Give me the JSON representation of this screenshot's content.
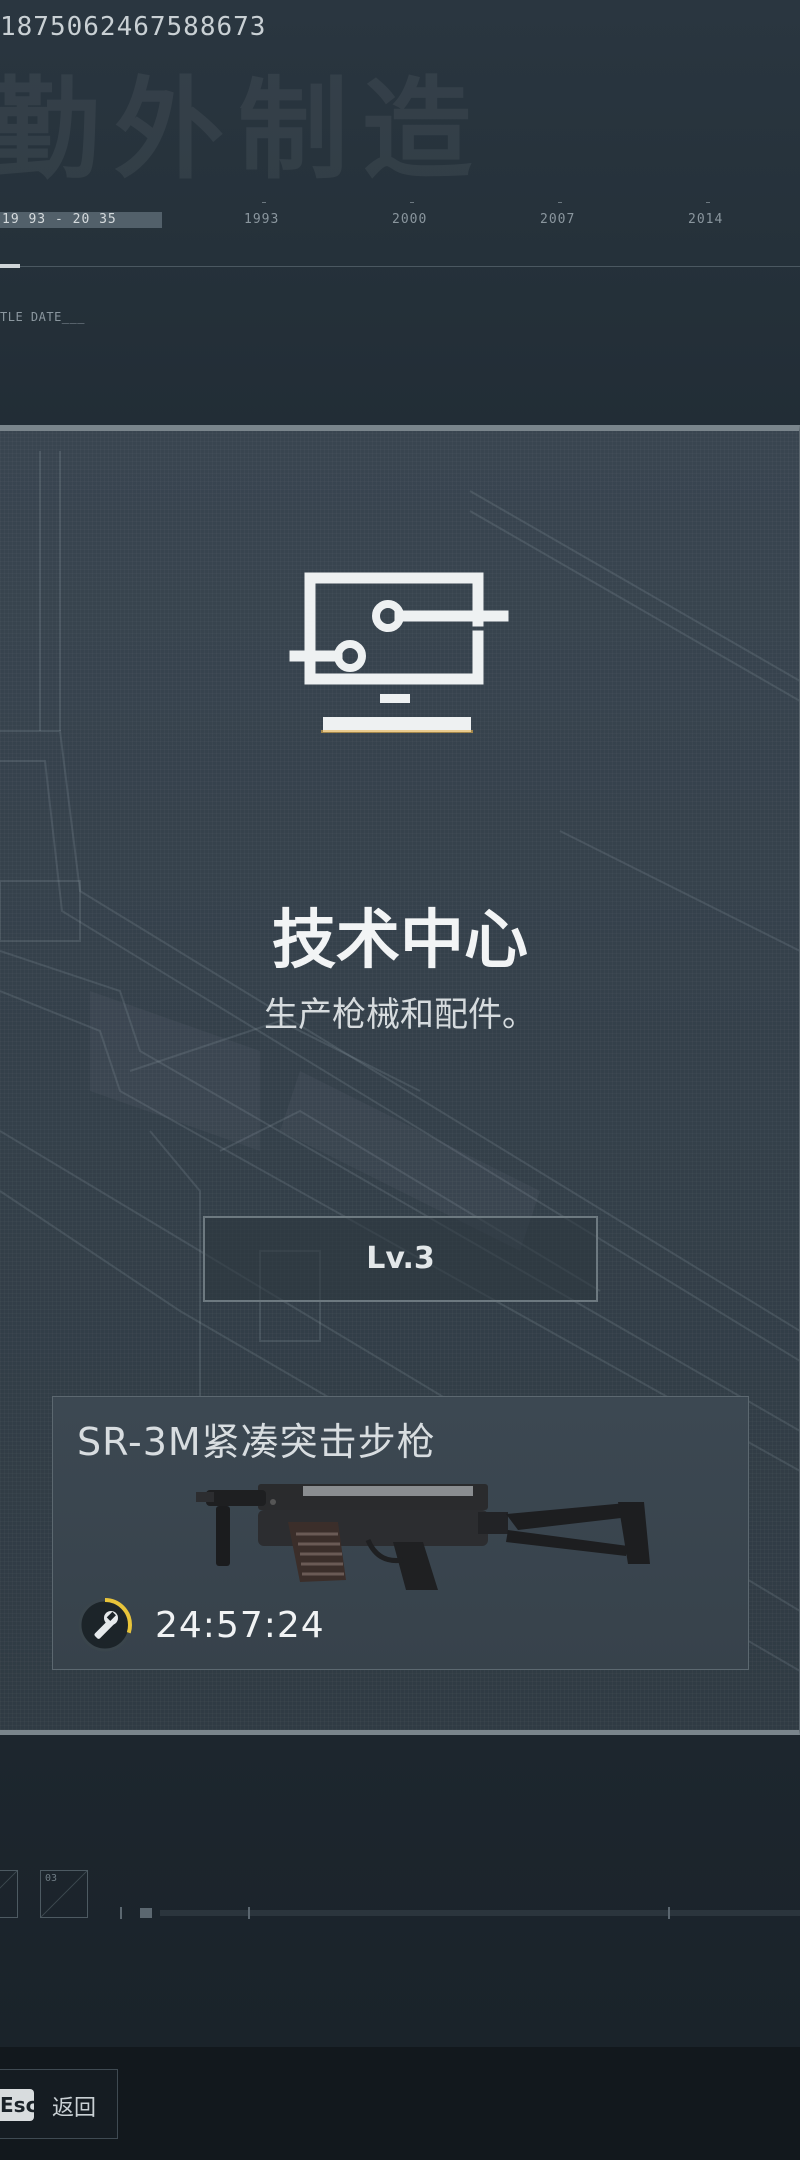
{
  "header": {
    "session_id": "1875062467588673",
    "background_title": "勤外制造",
    "timeline": {
      "range_label": "19 93 - 20 35",
      "years": [
        "1993",
        "2000",
        "2007",
        "2014"
      ]
    },
    "date_label": "TLE DATE___"
  },
  "card": {
    "icon": "monitor-icon",
    "title": "技术中心",
    "description": "生产枪械和配件。",
    "level_label": "Lv.3",
    "production": {
      "item_name": "SR-3M紧凑突击步枪",
      "item_image": "rifle-image",
      "timer_icon": "wrench-icon",
      "timer": "24:57:24",
      "progress": 0.3,
      "accent_color": "#e8c43a"
    }
  },
  "lower": {
    "slot_number": "03"
  },
  "footer": {
    "esc_key": "Esc",
    "back_label": "返回"
  }
}
